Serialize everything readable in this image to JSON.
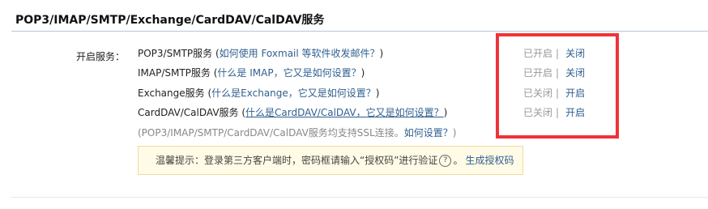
{
  "section": {
    "title": "POP3/IMAP/SMTP/Exchange/CardDAV/CalDAV服务"
  },
  "enable_label": "开启服务：",
  "services": [
    {
      "name": "POP3/SMTP服务",
      "open_paren": " (",
      "help": "如何使用 Foxmail 等软件收发邮件？",
      "close_paren": ")",
      "status": "已开启",
      "separator": "|",
      "action": "关闭"
    },
    {
      "name": "IMAP/SMTP服务",
      "open_paren": " (",
      "help": "什么是 IMAP，它又是如何设置？",
      "close_paren": ")",
      "status": "已开启",
      "separator": "|",
      "action": "关闭"
    },
    {
      "name": "Exchange服务",
      "open_paren": " (",
      "help": "什么是Exchange，它又是如何设置？",
      "close_paren": ")",
      "status": "已关闭",
      "separator": "|",
      "action": "开启"
    },
    {
      "name": "CardDAV/CalDAV服务",
      "open_paren": " (",
      "help": "什么是CardDAV/CalDAV，它又是如何设置？",
      "close_paren": ")",
      "status": "已关闭",
      "separator": "|",
      "action": "开启"
    }
  ],
  "ssl_note": {
    "prefix": "(POP3/IMAP/SMTP/CardDAV/CalDAV服务均支持SSL连接。",
    "link": "如何设置？",
    "suffix": ")"
  },
  "tip": {
    "text": "温馨提示：登录第三方客户端时，密码框请输入“授权码”进行验证",
    "help_icon": "?",
    "after_icon": "。",
    "link": "生成授权码"
  },
  "colors": {
    "highlight_border": "#ee3338",
    "link": "#2f5f8f",
    "tip_background": "#fffbe6"
  }
}
